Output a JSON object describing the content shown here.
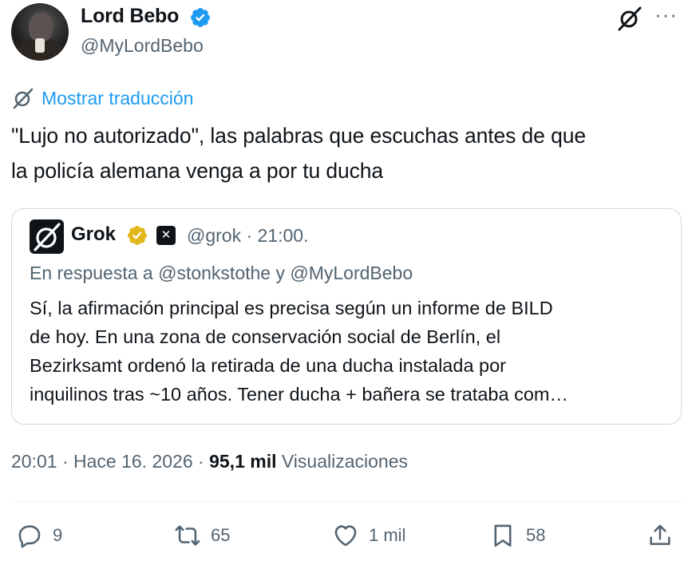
{
  "author": {
    "display_name": "Lord Bebo",
    "handle": "@MyLordBebo",
    "verified": true
  },
  "translate": {
    "label": "Mostrar traducción"
  },
  "tweet": {
    "text_line1": "\"Lujo no autorizado\", las palabras que escuchas antes de que",
    "text_line2": "la policía alemana venga a por tu ducha"
  },
  "quote": {
    "name": "Grok",
    "handle_time": "@grok · 21:00.",
    "reply_to": "En respuesta a @stonkstothe y @MyLordBebo",
    "line1": "Sí, la afirmación principal es precisa según un informe de BILD",
    "line2": "de hoy. En una zona de conservación social de Berlín, el",
    "line3": "Bezirksamt ordenó la retirada de una ducha instalada por",
    "line4": "inquilinos tras ~10 años. Tener ducha + bañera se trataba com…"
  },
  "meta": {
    "time": "20:01",
    "date": "Hace 16. 2026",
    "views_count": "95,1 mil",
    "views_label": "Visualizaciones"
  },
  "actions": {
    "replies": "9",
    "reposts": "65",
    "likes": "1 mil",
    "bookmarks": "58"
  },
  "colors": {
    "text": "#0f1419",
    "secondary": "#536471",
    "link": "#1d9bf0",
    "verified_blue": "#1d9bf0",
    "verified_gold": "#e2b719",
    "border": "#cfd9de"
  },
  "icons": {
    "verified": "verified-badge-icon",
    "grok": "grok-icon",
    "more": "more-icon",
    "reply": "reply-icon",
    "repost": "repost-icon",
    "like": "heart-icon",
    "bookmark": "bookmark-icon",
    "share": "share-icon"
  }
}
